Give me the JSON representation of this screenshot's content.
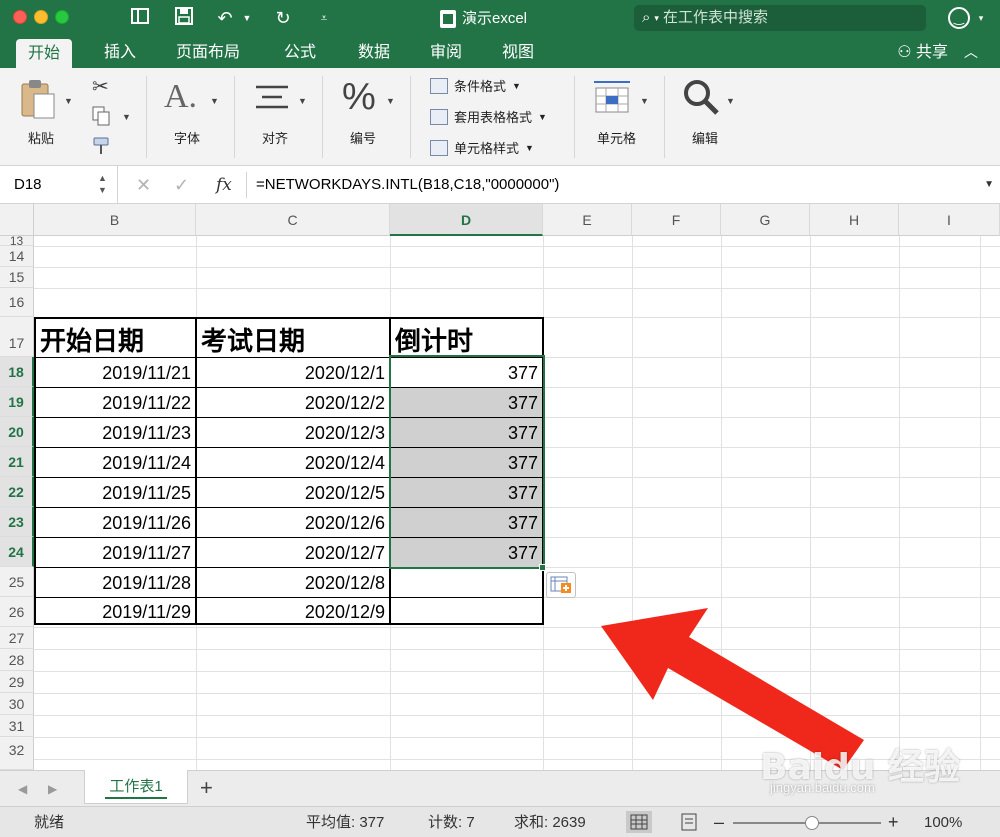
{
  "app": {
    "document_title": "演示excel",
    "search_placeholder": "在工作表中搜索"
  },
  "tabs": [
    {
      "label": "开始",
      "active": true
    },
    {
      "label": "插入",
      "active": false
    },
    {
      "label": "页面布局",
      "active": false
    },
    {
      "label": "公式",
      "active": false
    },
    {
      "label": "数据",
      "active": false
    },
    {
      "label": "审阅",
      "active": false
    },
    {
      "label": "视图",
      "active": false
    }
  ],
  "share_label": "共享",
  "ribbon": {
    "paste": "粘贴",
    "font": "字体",
    "align": "对齐",
    "number": "编号",
    "cond_format": "条件格式",
    "table_format": "套用表格格式",
    "cell_style": "单元格样式",
    "cells": "单元格",
    "edit": "编辑"
  },
  "formula_bar": {
    "name_box": "D18",
    "formula": "=NETWORKDAYS.INTL(B18,C18,\"0000000\")"
  },
  "columns": [
    "B",
    "C",
    "D",
    "E",
    "F",
    "G",
    "H",
    "I"
  ],
  "row_numbers": [
    "13",
    "14",
    "15",
    "16",
    "17",
    "18",
    "19",
    "20",
    "21",
    "22",
    "23",
    "24",
    "25",
    "26",
    "27",
    "28",
    "29",
    "30",
    "31",
    "32"
  ],
  "table": {
    "headers": [
      "开始日期",
      "考试日期",
      "倒计时"
    ],
    "rows": [
      [
        "2019/11/21",
        "2020/12/1",
        "377"
      ],
      [
        "2019/11/22",
        "2020/12/2",
        "377"
      ],
      [
        "2019/11/23",
        "2020/12/3",
        "377"
      ],
      [
        "2019/11/24",
        "2020/12/4",
        "377"
      ],
      [
        "2019/11/25",
        "2020/12/5",
        "377"
      ],
      [
        "2019/11/26",
        "2020/12/6",
        "377"
      ],
      [
        "2019/11/27",
        "2020/12/7",
        "377"
      ],
      [
        "2019/11/28",
        "2020/12/8",
        ""
      ],
      [
        "2019/11/29",
        "2020/12/9",
        ""
      ]
    ]
  },
  "sheet_tab": "工作表1",
  "status": {
    "ready": "就绪",
    "average": "平均值: 377",
    "count": "计数: 7",
    "sum": "求和: 2639",
    "zoom": "100%"
  },
  "watermark": {
    "brand": "Baidu 经验",
    "url": "jingyan.baidu.com"
  },
  "colors": {
    "excel_green": "#227447",
    "annotation_red": "#f0271b"
  }
}
